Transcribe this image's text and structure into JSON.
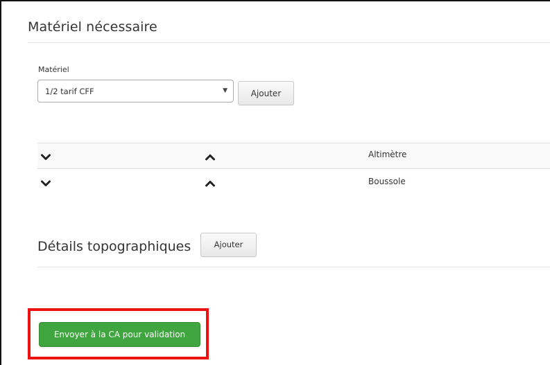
{
  "materiel_section": {
    "title": "Matériel nécessaire",
    "field_label": "Matériel",
    "select_value": "1/2 tarif CFF",
    "add_label": "Ajouter"
  },
  "materiel_list": {
    "rows": [
      {
        "label": "Altimètre",
        "down_icon": "chevron-down-icon",
        "up_icon": "chevron-up-icon"
      },
      {
        "label": "Boussole",
        "down_icon": "chevron-down-icon",
        "up_icon": "chevron-up-icon"
      }
    ]
  },
  "topo_section": {
    "title": "Détails topographiques",
    "add_label": "Ajouter"
  },
  "submit": {
    "label": "Envoyer à la CA pour validation",
    "color": "#3fa63f",
    "highlight_color": "#ee1111"
  }
}
